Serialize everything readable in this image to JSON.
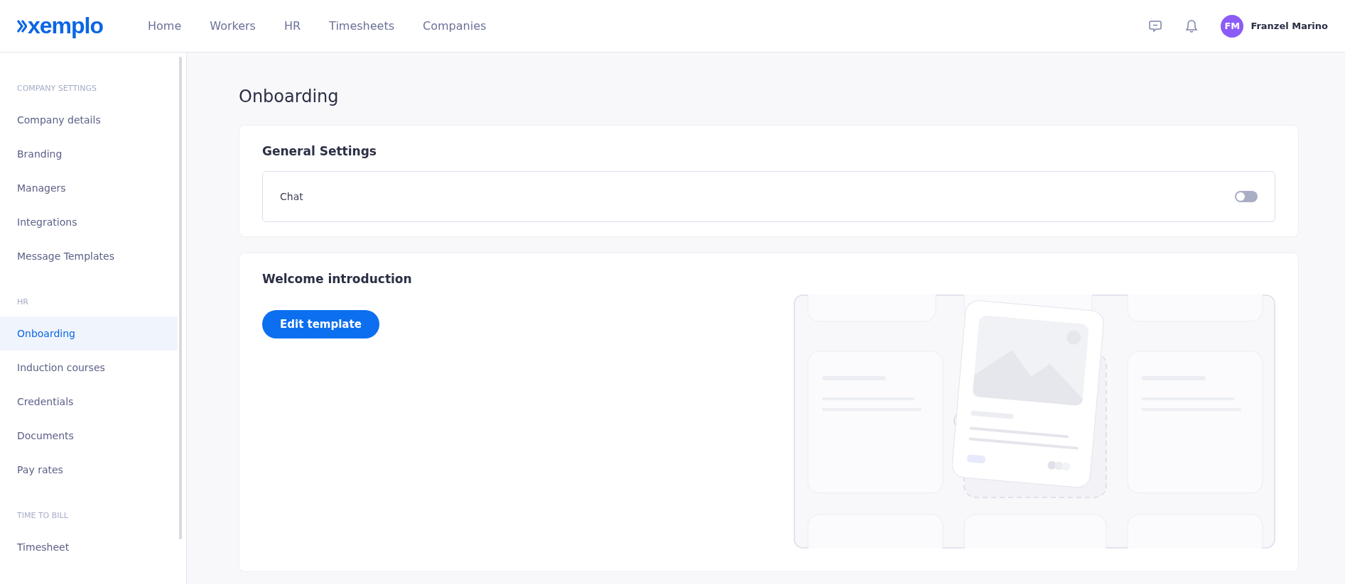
{
  "header": {
    "logo": "xemplo",
    "nav": [
      {
        "label": "Home",
        "selected": false
      },
      {
        "label": "Workers",
        "selected": false
      },
      {
        "label": "HR",
        "selected": false
      },
      {
        "label": "Timesheets",
        "selected": false
      },
      {
        "label": "Companies",
        "selected": false
      }
    ],
    "user": {
      "initials": "FM",
      "name": "Franzel Marino"
    }
  },
  "sidebar": {
    "sections": [
      {
        "heading": "COMPANY SETTINGS",
        "items": [
          {
            "label": "Company details",
            "selected": false
          },
          {
            "label": "Branding",
            "selected": false
          },
          {
            "label": "Managers",
            "selected": false
          },
          {
            "label": "Integrations",
            "selected": false
          },
          {
            "label": "Message Templates",
            "selected": false
          }
        ]
      },
      {
        "heading": "HR",
        "items": [
          {
            "label": "Onboarding",
            "selected": true
          },
          {
            "label": "Induction courses",
            "selected": false
          },
          {
            "label": "Credentials",
            "selected": false
          },
          {
            "label": "Documents",
            "selected": false
          },
          {
            "label": "Pay rates",
            "selected": false
          }
        ]
      },
      {
        "heading": "TIME TO BILL",
        "items": [
          {
            "label": "Timesheet",
            "selected": false
          }
        ]
      }
    ]
  },
  "page": {
    "title": "Onboarding",
    "general_settings": {
      "title": "General Settings",
      "settings": [
        {
          "label": "Chat",
          "on": false
        }
      ]
    },
    "welcome": {
      "title": "Welcome introduction",
      "button": "Edit template"
    }
  }
}
